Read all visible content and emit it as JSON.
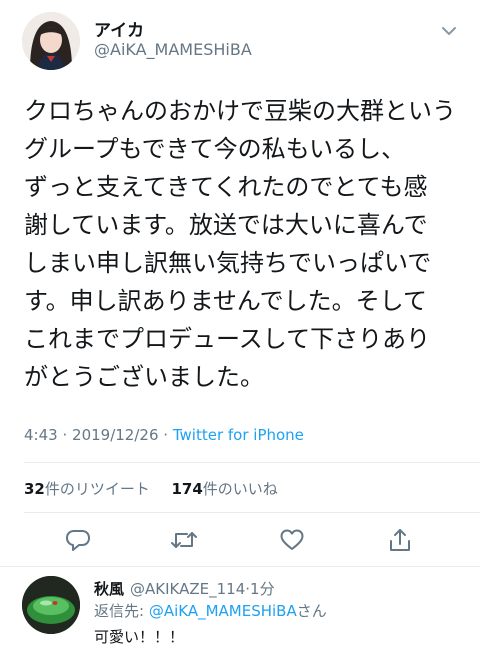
{
  "tweet": {
    "display_name": "アイカ",
    "handle": "@AiKA_MAMESHiBA",
    "body": "クロちゃんのおかけで豆柴の大群という\nグループもできて今の私もいるし、\nずっと支えてきてくれたのでとても感\n謝しています。放送では大いに喜んで\nしまい申し訳無い気持ちでいっぱいで\nす。申し訳ありませんでした。そして\nこれまでプロデュースして下さりあり\nがとうございました。",
    "time": "4:43",
    "date": "2019/12/26",
    "separator": "·",
    "source": "Twitter for iPhone"
  },
  "stats": {
    "retweets_count": "32",
    "retweets_label": "件のリツイート",
    "likes_count": "174",
    "likes_label": "件のいいね"
  },
  "actions": [
    {
      "name": "reply",
      "icon": "reply-icon"
    },
    {
      "name": "retweet",
      "icon": "retweet-icon"
    },
    {
      "name": "like",
      "icon": "heart-icon"
    },
    {
      "name": "share",
      "icon": "share-icon"
    }
  ],
  "reply": {
    "display_name": "秋風",
    "handle": "@AKIKAZE_114",
    "time": "1分",
    "replying_prefix": "返信先: ",
    "replying_to": "@AiKA_MAMESHiBA",
    "replying_suffix": "さん",
    "text": "可愛い！！！"
  },
  "colors": {
    "accent": "#1da1f2",
    "secondary_text": "#657786",
    "primary_text": "#14171a",
    "divider": "#e6ecf0"
  }
}
